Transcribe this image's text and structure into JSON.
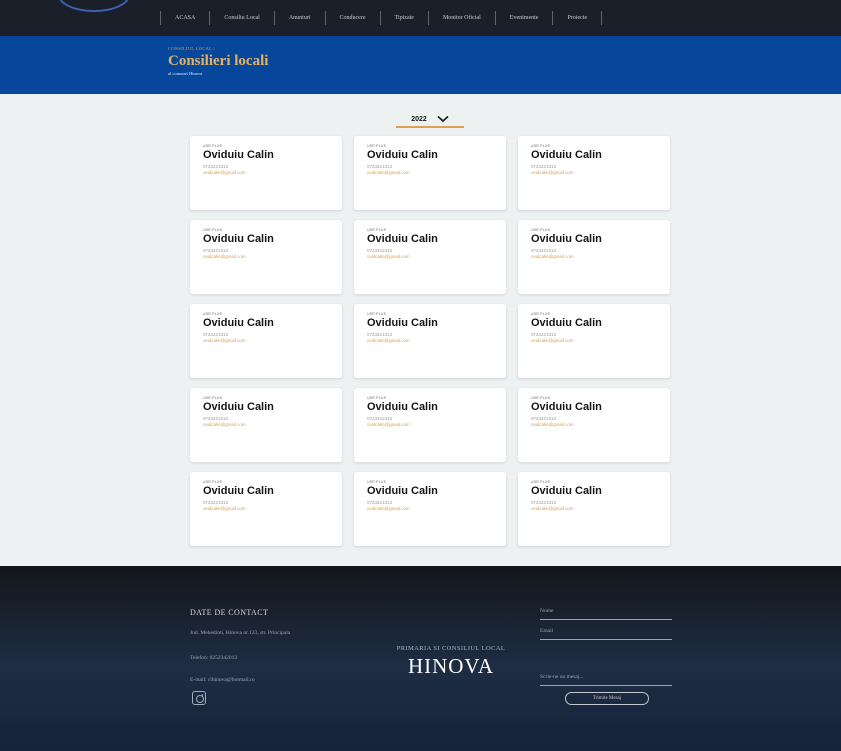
{
  "nav": {
    "items": [
      "ACASA",
      "Consiliu Local",
      "Anunturi",
      "Conducere",
      "Tipizate",
      "Monitor Oficial",
      "Evenimente",
      "Proiecte"
    ]
  },
  "hero": {
    "kicker": "CONSILIUL LOCAL /",
    "title": "Consilieri locali",
    "subtitle": "al comunei Hinova"
  },
  "filter": {
    "year": "2022",
    "icon": "chevron-down-icon"
  },
  "councillors": [
    {
      "party": "USR PLUS",
      "name": "Oviduiu Calin",
      "phone": "0723421313",
      "email": "ovidcalin@gmail.com"
    },
    {
      "party": "USR PLUS",
      "name": "Oviduiu Calin",
      "phone": "0723421313",
      "email": "ovidcalin@gmail.com"
    },
    {
      "party": "USR PLUS",
      "name": "Oviduiu Calin",
      "phone": "0723421313",
      "email": "ovidcalin@gmail.com"
    },
    {
      "party": "USR PLUS",
      "name": "Oviduiu Calin",
      "phone": "0723421313",
      "email": "ovidcalin@gmail.com"
    },
    {
      "party": "USR PLUS",
      "name": "Oviduiu Calin",
      "phone": "0723421313",
      "email": "ovidcalin@gmail.com"
    },
    {
      "party": "USR PLUS",
      "name": "Oviduiu Calin",
      "phone": "0723421313",
      "email": "ovidcalin@gmail.com"
    },
    {
      "party": "USR PLUS",
      "name": "Oviduiu Calin",
      "phone": "0723421313",
      "email": "ovidcalin@gmail.com"
    },
    {
      "party": "USR PLUS",
      "name": "Oviduiu Calin",
      "phone": "0723421313",
      "email": "ovidcalin@gmail.com"
    },
    {
      "party": "USR PLUS",
      "name": "Oviduiu Calin",
      "phone": "0723421313",
      "email": "ovidcalin@gmail.com"
    },
    {
      "party": "USR PLUS",
      "name": "Oviduiu Calin",
      "phone": "0723421313",
      "email": "ovidcalin@gmail.com"
    },
    {
      "party": "USR PLUS",
      "name": "Oviduiu Calin",
      "phone": "0723421313",
      "email": "ovidcalin@gmail.com"
    },
    {
      "party": "USR PLUS",
      "name": "Oviduiu Calin",
      "phone": "0723421313",
      "email": "ovidcalin@gmail.com"
    },
    {
      "party": "USR PLUS",
      "name": "Oviduiu Calin",
      "phone": "0723421313",
      "email": "ovidcalin@gmail.com"
    },
    {
      "party": "USR PLUS",
      "name": "Oviduiu Calin",
      "phone": "0723421313",
      "email": "ovidcalin@gmail.com"
    },
    {
      "party": "USR PLUS",
      "name": "Oviduiu Calin",
      "phone": "0723421313",
      "email": "ovidcalin@gmail.com"
    }
  ],
  "footer": {
    "contact_heading": "DATE DE CONTACT",
    "address": "Jud. Mehedinti, Hinova nr.123, str. Principala",
    "phone": "Telefon: 0252342013",
    "email": "E-mail: clhinova@hotmail.ro",
    "brand_top": "PRIMARIA SI CONSILIUL LOCAL",
    "brand": "HINOVA",
    "form": {
      "name_placeholder": "Nume",
      "email_placeholder": "Email",
      "message_placeholder": "Scrie-ne un mesaj...",
      "send_label": "Trimite Mesaj"
    }
  },
  "colors": {
    "nav_bg": "#1b1f2a",
    "hero_bg": "#06479c",
    "accent_gold": "#e0a14f",
    "main_bg": "#eef1f2",
    "footer_bg": "#1e2d44"
  }
}
